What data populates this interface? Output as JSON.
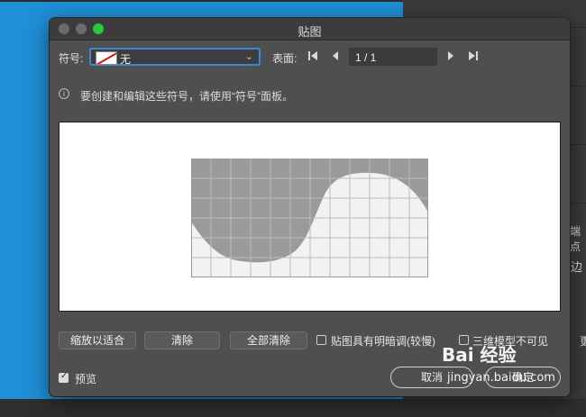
{
  "background": {
    "side_label_1": "端点",
    "side_label_2": "边",
    "side_button": "更"
  },
  "dialog": {
    "title": "贴图",
    "symbol_label": "符号:",
    "symbol_value": "无",
    "surface_label": "表面:",
    "page_value": "1 / 1",
    "info_text": "要创建和编辑这些符号，请使用“符号”面板。",
    "buttons": {
      "fit": "缩放以适合",
      "clear": "清除",
      "clear_all": "全部清除",
      "cancel": "取消",
      "ok": "确定"
    },
    "checkboxes": {
      "shading": {
        "label": "贴图具有明暗调(较慢)",
        "checked": false
      },
      "invisible": {
        "label": "三维模型不可见",
        "checked": false
      },
      "preview": {
        "label": "预览",
        "checked": true
      }
    }
  },
  "watermark": {
    "brand": "Bai 经验",
    "url": "jingyan.baidu.com"
  },
  "colors": {
    "dialog_bg": "#4f4f4f",
    "focus_ring": "#3d87d6",
    "desktop": "#1f8fd6",
    "surface_gray": "#9a9a9a",
    "surface_light": "#f2f2f2"
  }
}
